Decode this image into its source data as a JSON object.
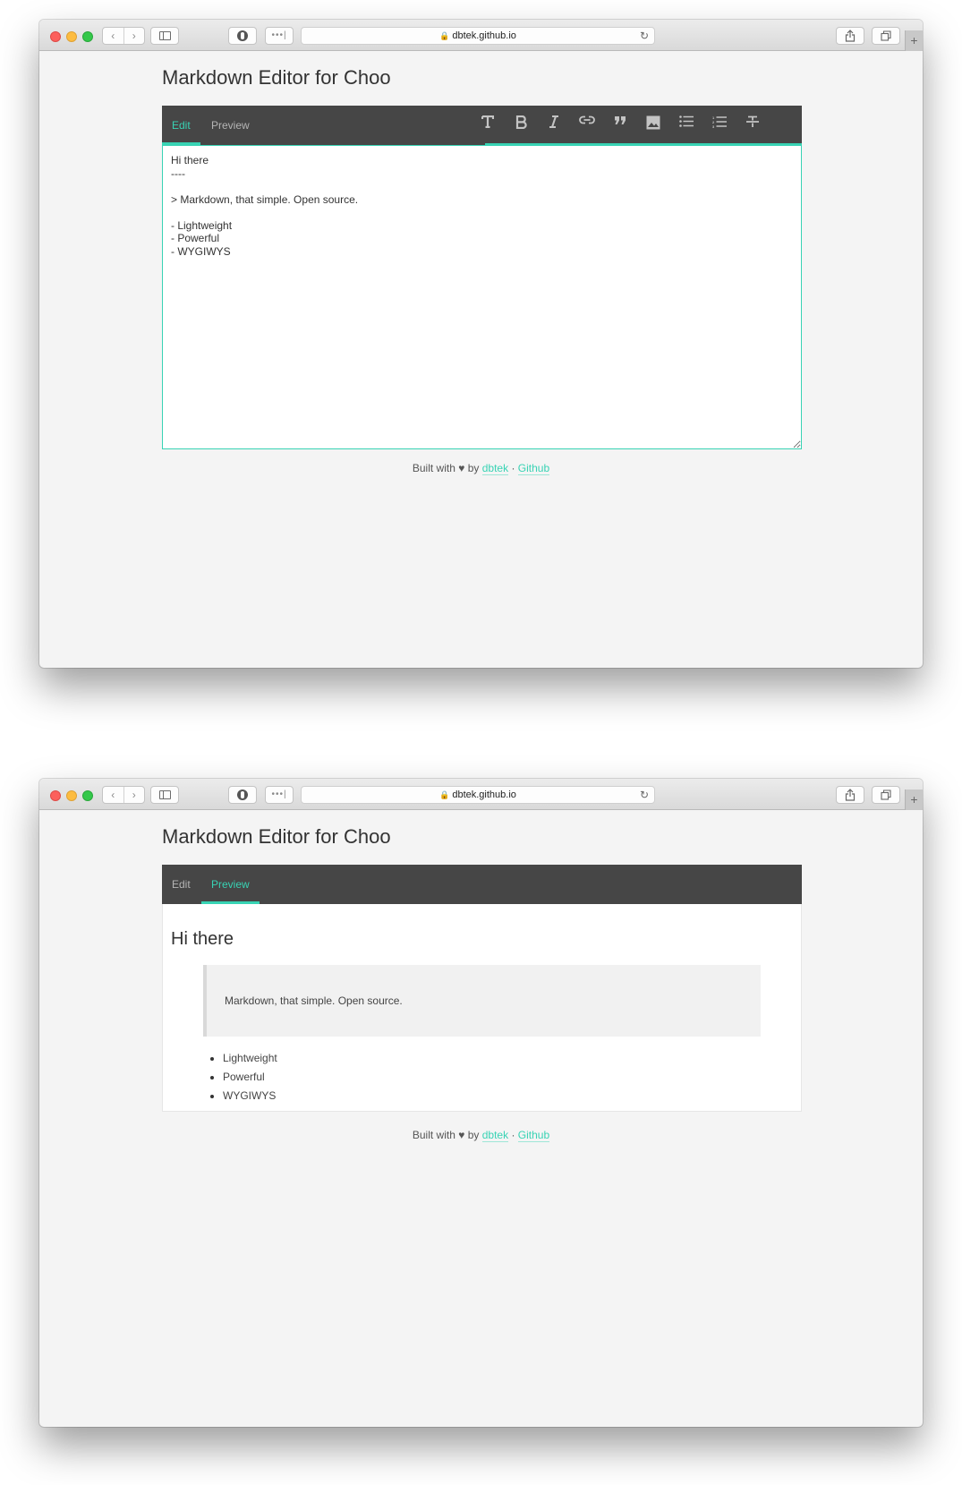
{
  "browser": {
    "url": "dbtek.github.io"
  },
  "page": {
    "title": "Markdown Editor for Choo",
    "tabs": {
      "edit": "Edit",
      "preview": "Preview"
    }
  },
  "toolbar": {
    "buttons": [
      "heading",
      "bold",
      "italic",
      "link",
      "quote",
      "image",
      "bullet-list",
      "numbered-list",
      "strikethrough"
    ]
  },
  "editor": {
    "content": "Hi there\n----\n\n> Markdown, that simple. Open source.\n\n- Lightweight\n- Powerful\n- WYGIWYS"
  },
  "preview": {
    "heading": "Hi there",
    "quote": "Markdown, that simple. Open source.",
    "items": [
      "Lightweight",
      "Powerful",
      "WYGIWYS"
    ]
  },
  "footer": {
    "built_with": "Built with",
    "heart": "♥",
    "by": "by",
    "author_link": "dbtek",
    "separator": "·",
    "github_link": "Github"
  },
  "colors": {
    "accent": "#38d3b4",
    "toolbar_bg": "#464646",
    "page_bg": "#f4f4f4"
  }
}
